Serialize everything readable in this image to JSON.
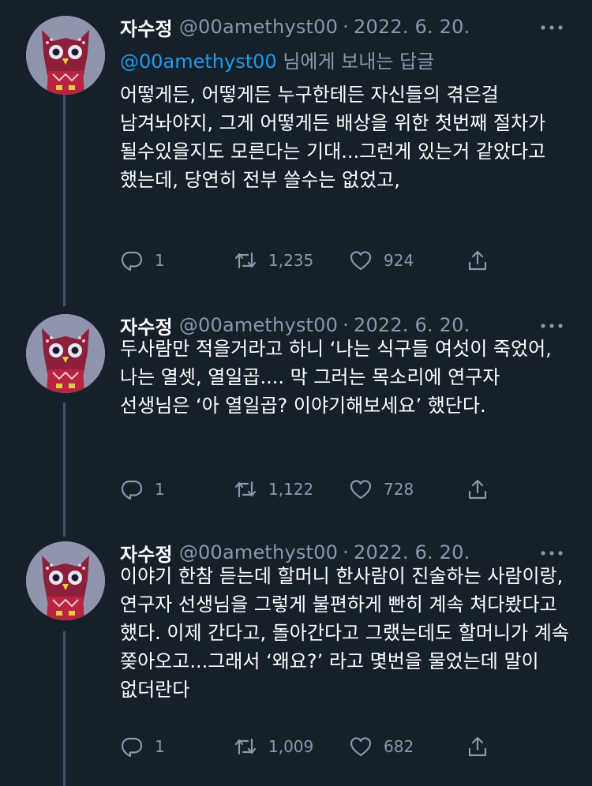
{
  "tweets": [
    {
      "name": "자수정",
      "handle": "@00amethyst00",
      "separator": "·",
      "date": "2022. 6. 20.",
      "reply_mention": "@00amethyst00",
      "reply_suffix": " 님에게 보내는 답글",
      "text": "어떻게든, 어떻게든 누구한테든 자신들의 겪은걸 남겨놔야지, 그게 어떻게든 배상을 위한 첫번째 절차가 될수있을지도 모른다는 기대...그런게 있는거 같았다고 했는데, 당연히 전부 쓸수는 없었고,",
      "replies": "1",
      "retweets": "1,235",
      "likes": "924"
    },
    {
      "name": "자수정",
      "handle": "@00amethyst00",
      "separator": "·",
      "date": "2022. 6. 20.",
      "text": "두사람만 적을거라고 하니 ‘나는 식구들 여섯이 죽었어, 나는 열셋, 열일곱.... 막 그러는 목소리에 연구자 선생님은 ‘아 열일곱? 이야기해보세요’ 했단다.",
      "replies": "1",
      "retweets": "1,122",
      "likes": "728"
    },
    {
      "name": "자수정",
      "handle": "@00amethyst00",
      "separator": "·",
      "date": "2022. 6. 20.",
      "text": "이야기 한참 듣는데 할머니 한사람이 진술하는 사람이랑, 연구자 선생님을 그렇게 불편하게 빤히 계속 쳐다봤다고 했다. 이제 간다고, 돌아간다고 그랬는데도 할머니가 계속 쫒아오고...그래서 ‘왜요?’ 라고 몇번을 물었는데 말이 없더란다",
      "replies": "1",
      "retweets": "1,009",
      "likes": "682"
    }
  ],
  "colors": {
    "background": "#15202b",
    "secondary_text": "#8b98a5",
    "link": "#1d9bf0",
    "thread_line": "#3d5466"
  },
  "icons": [
    "owl-avatar",
    "more-icon",
    "reply-icon",
    "retweet-icon",
    "like-icon",
    "share-icon"
  ]
}
